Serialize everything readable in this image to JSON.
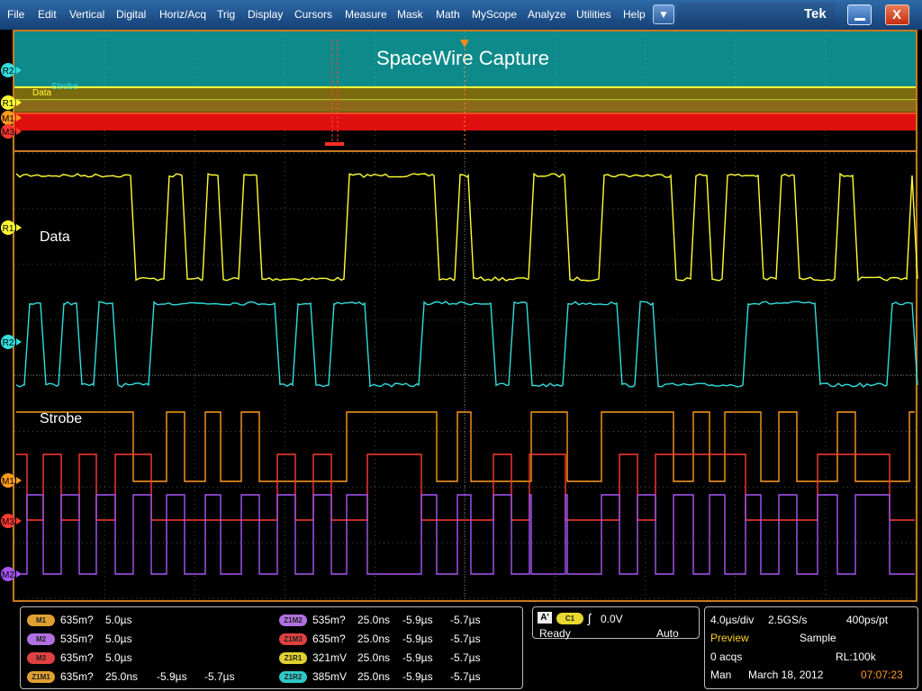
{
  "menubar": {
    "items": [
      "File",
      "Edit",
      "Vertical",
      "Digital",
      "Horiz/Acq",
      "Trig",
      "Display",
      "Cursors",
      "Measure",
      "Mask",
      "Math",
      "MyScope",
      "Analyze",
      "Utilities",
      "Help"
    ],
    "dropdown_glyph": "▼",
    "brand": "Tek",
    "close_glyph": "X"
  },
  "display": {
    "overview_title": "SpaceWire Capture",
    "overview_labels": {
      "strobe": "Strobe",
      "data": "Data"
    },
    "trace_labels": {
      "data": "Data",
      "strobe": "Strobe"
    },
    "markers": {
      "r2": "R2",
      "r1": "R1",
      "m1": "M1",
      "m3": "M3",
      "m2": "M2"
    }
  },
  "colors": {
    "r1": "#ffff33",
    "r2": "#33dddd",
    "m1": "#ff9a1f",
    "m3": "#ff3b30",
    "m2": "#a855f7",
    "overview_bg": "#0e8a8a",
    "frame": "#c87a1e",
    "grid": "#555555"
  },
  "measurements": {
    "left": [
      {
        "badge": "M1",
        "color": "#e0a030",
        "values": [
          "635m?",
          "5.0µs",
          "",
          ""
        ]
      },
      {
        "badge": "M2",
        "color": "#b070e0",
        "values": [
          "535m?",
          "5.0µs",
          "",
          ""
        ]
      },
      {
        "badge": "M3",
        "color": "#e04040",
        "values": [
          "635m?",
          "5.0µs",
          "",
          ""
        ]
      },
      {
        "badge": "Z1M1",
        "color": "#e0a030",
        "values": [
          "635m?",
          "25.0ns",
          "-5.9µs",
          "-5.7µs"
        ]
      }
    ],
    "right": [
      {
        "badge": "Z1M2",
        "color": "#b070e0",
        "values": [
          "535m?",
          "25.0ns",
          "-5.9µs",
          "-5.7µs"
        ]
      },
      {
        "badge": "Z1M3",
        "color": "#e04040",
        "values": [
          "635m?",
          "25.0ns",
          "-5.9µs",
          "-5.7µs"
        ]
      },
      {
        "badge": "Z1R1",
        "color": "#e0d030",
        "values": [
          "321mV",
          "25.0ns",
          "-5.9µs",
          "-5.7µs"
        ]
      },
      {
        "badge": "Z1R2",
        "color": "#30c8c8",
        "values": [
          "385mV",
          "25.0ns",
          "-5.9µs",
          "-5.7µs"
        ]
      }
    ]
  },
  "trigger": {
    "mode_badge": "A'",
    "source_badge": "C1",
    "slope_glyph": "ʃ",
    "level": "0.0V",
    "state": "Ready",
    "mode": "Auto"
  },
  "acquisition": {
    "time_per_div": "4.0µs/div",
    "sample_rate": "2.5GS/s",
    "resolution": "400ps/pt",
    "preview": "Preview",
    "mode": "Sample",
    "acqs": "0 acqs",
    "record_length": "RL:100k",
    "trigger_mode": "Man",
    "date": "March 18, 2012",
    "time": "07:07:23"
  }
}
